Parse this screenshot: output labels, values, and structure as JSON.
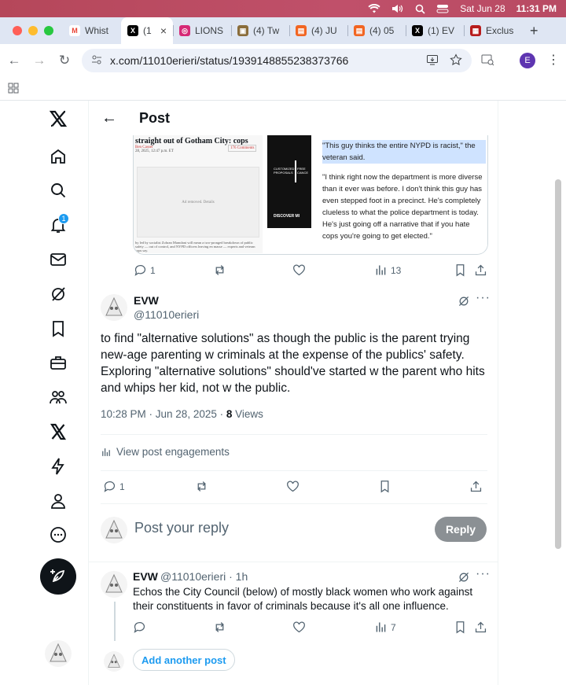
{
  "menubar": {
    "date": "Sat Jun 28",
    "time": "11:31 PM"
  },
  "tabs": [
    {
      "label": "Whist",
      "favicon": "M",
      "color": "#ea4335"
    },
    {
      "label": "(1",
      "favicon": "X",
      "color": "#000000",
      "active": true
    },
    {
      "label": "LIONS",
      "favicon": "◎",
      "color": "#d62976"
    },
    {
      "label": "(4) Tw",
      "favicon": "▣",
      "color": "#8a6d3b"
    },
    {
      "label": "(4) JU",
      "favicon": "▤",
      "color": "#f26522"
    },
    {
      "label": "(4) 05",
      "favicon": "▤",
      "color": "#f26522"
    },
    {
      "label": "(1) EV",
      "favicon": "X",
      "color": "#000000"
    },
    {
      "label": "Exclus",
      "favicon": "▦",
      "color": "#b71c1c"
    }
  ],
  "browser": {
    "url": "x.com/11010erieri/status/1939148855238373766",
    "profile_initial": "E"
  },
  "header": {
    "title": "Post"
  },
  "nav": {
    "notification_count": "1"
  },
  "image": {
    "headline": "straight out of Gotham City: cops",
    "byline": "Ben Casser",
    "timestamp_small": "28, 2025, 12:47 p.m. ET",
    "comments_label": "176 Comments",
    "ad_text": "Ad removed. Details",
    "caption": "by led by socialist Zohran Mamdani will mean a two-pronged breakdown of public safety — out of control, and NYPD officers leaving en masse — experts and veteran cops say.",
    "mid_labels": [
      "CUSTOMIZED PROPOSALS",
      "FREE CANCE"
    ],
    "discover": "DISCOVER MI",
    "quote1": "\"This guy thinks the entire NYPD is racist,\" the veteran said.",
    "quote2": "\"I think right now the department is more diverse than it ever was before. I don't think this guy has even stepped foot in a precinct. He's completely clueless to what the police department is today. He's just going off a narrative that if you hate cops you're going to get elected.\""
  },
  "parent_actions": {
    "replies": "1",
    "views": "13"
  },
  "tweet": {
    "name": "EVW",
    "handle": "@11010erieri",
    "text": "to find \"alternative solutions\" as though the public is the parent trying new-age parenting w criminals at the expense of the publics' safety. Exploring \"alternative solutions\" should've started w the parent who hits and whips her kid, not w the public.",
    "time": "10:28 PM · Jun 28, 2025 · ",
    "views_count": "8",
    "views_label": " Views",
    "engagements": "View post engagements",
    "replies": "1"
  },
  "composer": {
    "placeholder": "Post your reply",
    "button": "Reply"
  },
  "reply": {
    "name": "EVW",
    "handle": "@11010erieri · 1h",
    "text": "Echos the City Council (below) of mostly black women who work against their constituents in favor of criminals because it's all one influence.",
    "views": "7",
    "add_another": "Add another post"
  }
}
